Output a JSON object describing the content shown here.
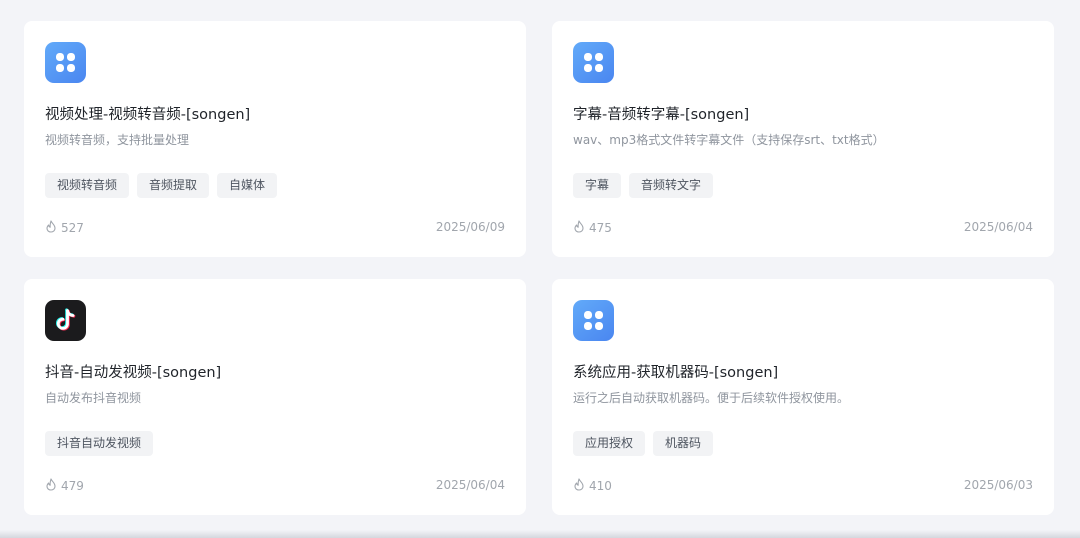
{
  "colors": {
    "accent_blue": "#4a86f0",
    "card_bg": "#ffffff",
    "page_bg": "#f3f4f8"
  },
  "cards": [
    {
      "icon": "app-grid-icon",
      "title": "视频处理-视频转音频-[songen]",
      "description": "视频转音频，支持批量处理",
      "tags": [
        "视频转音频",
        "音频提取",
        "自媒体"
      ],
      "stat_icon": "flame-icon",
      "views": "527",
      "date": "2025/06/09"
    },
    {
      "icon": "app-grid-icon",
      "title": "字幕-音频转字幕-[songen]",
      "description": "wav、mp3格式文件转字幕文件（支持保存srt、txt格式）",
      "tags": [
        "字幕",
        "音频转文字"
      ],
      "stat_icon": "flame-icon",
      "views": "475",
      "date": "2025/06/04"
    },
    {
      "icon": "tiktok-icon",
      "title": "抖音-自动发视频-[songen]",
      "description": "自动发布抖音视频",
      "tags": [
        "抖音自动发视频"
      ],
      "stat_icon": "flame-icon",
      "views": "479",
      "date": "2025/06/04"
    },
    {
      "icon": "app-grid-icon",
      "title": "系统应用-获取机器码-[songen]",
      "description": "运行之后自动获取机器码。便于后续软件授权使用。",
      "tags": [
        "应用授权",
        "机器码"
      ],
      "stat_icon": "flame-icon",
      "views": "410",
      "date": "2025/06/03"
    }
  ]
}
